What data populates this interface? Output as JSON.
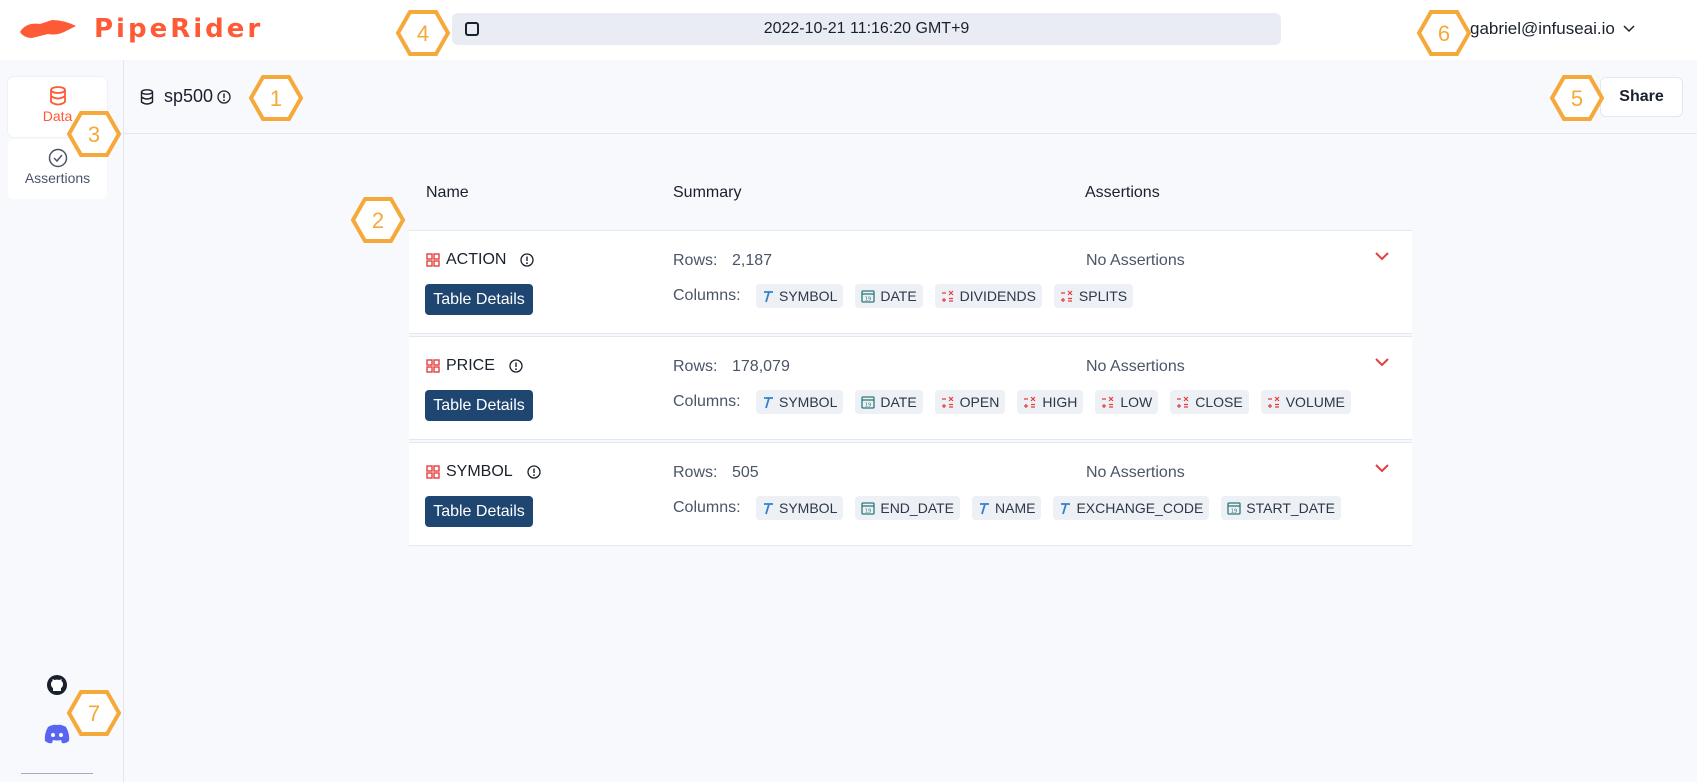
{
  "app": {
    "name": "PipeRider"
  },
  "topbar": {
    "datetime": "2022-10-21 11:16:20 GMT+9",
    "user_email": "gabriel@infuseai.io"
  },
  "sidebar": {
    "items": [
      {
        "label": "Data"
      },
      {
        "label": "Assertions"
      }
    ]
  },
  "header": {
    "database": "sp500",
    "share_label": "Share"
  },
  "columns_header": {
    "name": "Name",
    "summary": "Summary",
    "assertions": "Assertions"
  },
  "labels": {
    "rows": "Rows:",
    "columns": "Columns:",
    "details_button": "Table Details"
  },
  "tables": [
    {
      "name": "ACTION",
      "rows": "2,187",
      "assertions": "No Assertions",
      "columns": [
        {
          "name": "SYMBOL",
          "type": "text"
        },
        {
          "name": "DATE",
          "type": "date"
        },
        {
          "name": "DIVIDENDS",
          "type": "numeric"
        },
        {
          "name": "SPLITS",
          "type": "numeric"
        }
      ]
    },
    {
      "name": "PRICE",
      "rows": "178,079",
      "assertions": "No Assertions",
      "columns": [
        {
          "name": "SYMBOL",
          "type": "text"
        },
        {
          "name": "DATE",
          "type": "date"
        },
        {
          "name": "OPEN",
          "type": "numeric"
        },
        {
          "name": "HIGH",
          "type": "numeric"
        },
        {
          "name": "LOW",
          "type": "numeric"
        },
        {
          "name": "CLOSE",
          "type": "numeric"
        },
        {
          "name": "VOLUME",
          "type": "numeric"
        }
      ]
    },
    {
      "name": "SYMBOL",
      "rows": "505",
      "assertions": "No Assertions",
      "columns": [
        {
          "name": "SYMBOL",
          "type": "text"
        },
        {
          "name": "END_DATE",
          "type": "date"
        },
        {
          "name": "NAME",
          "type": "text"
        },
        {
          "name": "EXCHANGE_CODE",
          "type": "text"
        },
        {
          "name": "START_DATE",
          "type": "date"
        }
      ]
    }
  ],
  "callouts": [
    "1",
    "2",
    "3",
    "4",
    "5",
    "6",
    "7"
  ],
  "colors": {
    "brand": "#ff5a36",
    "button": "#1f4670",
    "callout": "#f6a93b",
    "text_type": "#3182ce",
    "date_type": "#2c7a7b",
    "numeric_type": "#e53e3e"
  }
}
